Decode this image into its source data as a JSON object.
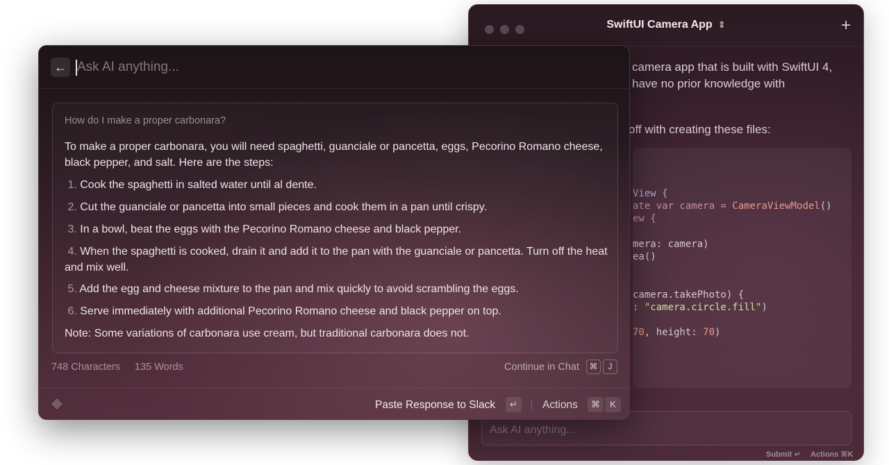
{
  "chat_window": {
    "title": "SwiftUI Camera App",
    "chevron_icon": "chevron-up-down-icon",
    "plus_icon": "plus-icon",
    "text_lines": [
      "camera app that is built with SwiftUI 4,",
      "have no prior knowledge with",
      "off with creating these files:"
    ],
    "code": {
      "line1": "View {",
      "line2a": "ate var camera = ",
      "line2b": "CameraViewModel",
      "line2c": "()",
      "line3": "ew {",
      "line4": "mera: camera)",
      "line5": "ea()",
      "line6": "camera.takePhoto) {",
      "line7a": ": ",
      "line7b": "\"camera.circle.fill\"",
      "line7c": ")",
      "line8a": "70",
      "line8b": ", height: ",
      "line8c": "70",
      "line8d": ")"
    },
    "input_placeholder": "Ask AI anything...",
    "footer_submit": "Submit ↵",
    "footer_actions": "Actions ⌘K"
  },
  "ai_panel": {
    "back_icon": "arrow-left-icon",
    "back_label": "←",
    "search_placeholder": "Ask AI anything...",
    "question": "How do I make a proper carbonara?",
    "intro": "To make a proper carbonara, you will need spaghetti, guanciale or pancetta, eggs, Pecorino Romano cheese, black pepper, and salt. Here are the steps:",
    "steps": [
      {
        "num": "1.",
        "text": "Cook the spaghetti in salted water until al dente."
      },
      {
        "num": "2.",
        "text": "Cut the guanciale or pancetta into small pieces and cook them in a pan until crispy."
      },
      {
        "num": "3.",
        "text": "In a bowl, beat the eggs with the Pecorino Romano cheese and black pepper."
      },
      {
        "num": "4.",
        "text": "When the spaghetti is cooked, drain it and add it to the pan with the guanciale or pancetta. Turn off the heat and mix well."
      },
      {
        "num": "5.",
        "text": "Add the egg and cheese mixture to the pan and mix quickly to avoid scrambling the eggs."
      },
      {
        "num": "6.",
        "text": "Serve immediately with additional Pecorino Romano cheese and black pepper on top."
      }
    ],
    "note": "Note: Some variations of carbonara use cream, but traditional carbonara does not.",
    "char_count": "748 Characters",
    "word_count": "135 Words",
    "continue_label": "Continue in Chat",
    "continue_keys": [
      "⌘",
      "J"
    ],
    "paste_label": "Paste Response to Slack",
    "enter_key": "↵",
    "actions_label": "Actions",
    "actions_keys": [
      "⌘",
      "K"
    ],
    "logo_icon": "raycast-logo-icon"
  }
}
